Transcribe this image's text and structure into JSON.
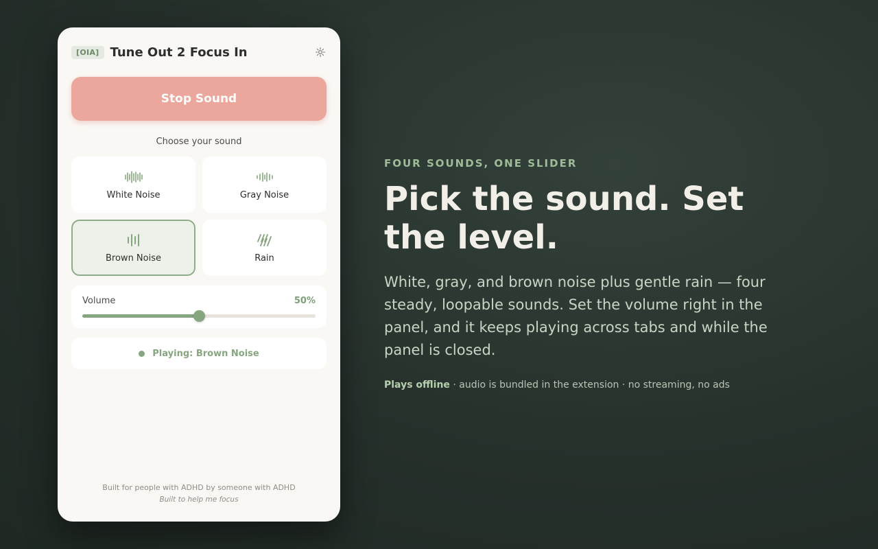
{
  "panel": {
    "badge": "[OIA]",
    "title": "Tune Out 2 Focus In",
    "stop_label": "Stop Sound",
    "choose_label": "Choose your sound",
    "sounds": [
      {
        "label": "White Noise",
        "icon": "waveform-icon",
        "selected": false
      },
      {
        "label": "Gray Noise",
        "icon": "waveform-small-icon",
        "selected": false
      },
      {
        "label": "Brown Noise",
        "icon": "bars-icon",
        "selected": true
      },
      {
        "label": "Rain",
        "icon": "rain-icon",
        "selected": false
      }
    ],
    "volume": {
      "label": "Volume",
      "value_text": "50%",
      "level": 0.5
    },
    "status": "Playing: Brown Noise",
    "footer_line1": "Built for people with ADHD by someone with ADHD",
    "footer_line2": "Built to help me focus"
  },
  "promo": {
    "eyebrow": "FOUR SOUNDS, ONE SLIDER",
    "headline": "Pick the sound. Set the level.",
    "description": "White, gray, and brown noise plus gentle rain — four steady, loopable sounds. Set the volume right in the panel, and it keeps playing across tabs and while the panel is closed.",
    "note_bold": "Plays offline",
    "note_rest": " · audio is bundled in the extension · no streaming, no ads"
  },
  "colors": {
    "accent": "#86a67f",
    "stop_button": "#eba79b",
    "background": "#26302b",
    "panel": "#faf8f5"
  }
}
